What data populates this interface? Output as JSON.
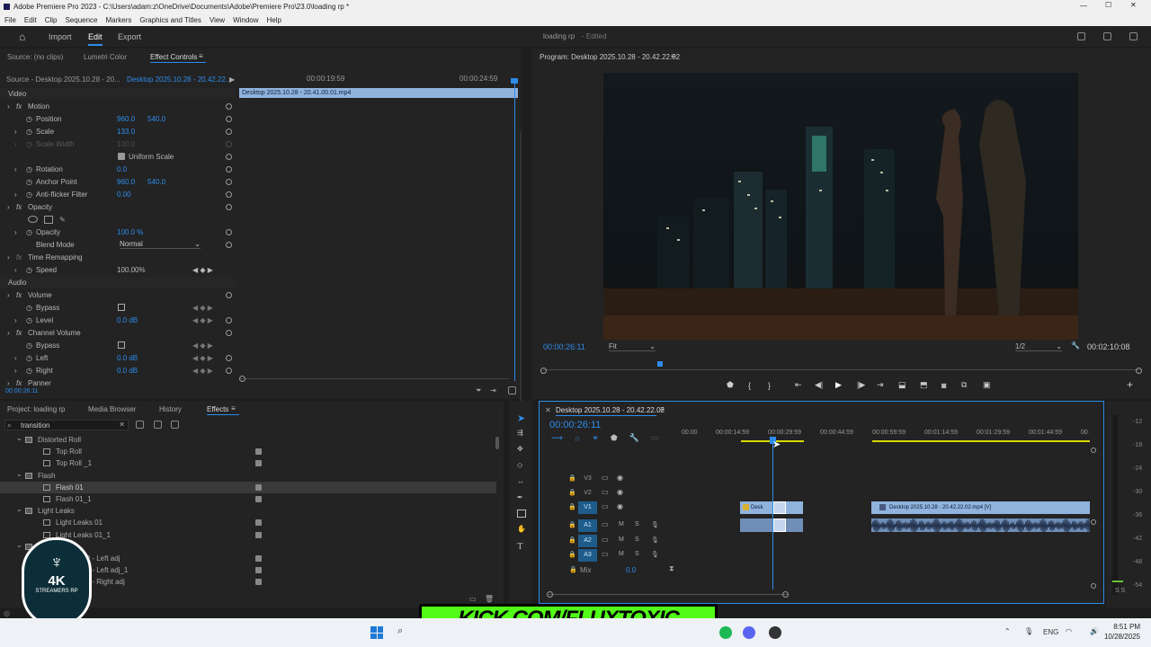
{
  "window": {
    "title": "Adobe Premiere Pro 2023 - C:\\Users\\adam:z\\OneDrive\\Documents\\Adobe\\Premiere Pro\\23.0\\loading rp *"
  },
  "menu": [
    "File",
    "Edit",
    "Clip",
    "Sequence",
    "Markers",
    "Graphics and Titles",
    "View",
    "Window",
    "Help"
  ],
  "workspace": {
    "tabs": [
      "Import",
      "Edit",
      "Export"
    ],
    "active": "Edit",
    "project_name": "loading rp",
    "status": "- Edited"
  },
  "source_panel": {
    "tabs": [
      "Source: (no clips)",
      "Lumetri Color",
      "Effect Controls"
    ],
    "source_clip": "Source - Desktop 2025.10.28 - 20...",
    "seq_clip": "Desktop 2025.10.28 - 20.42.22...",
    "timecode_a": "00:00:19:59",
    "timecode_b": "00:00:24:59",
    "clip_bar": "Desktop 2025.10.28 - 20.41.00.01.mp4",
    "current_time": "00:00:26:11"
  },
  "effects": {
    "video_header": "Video",
    "audio_header": "Audio",
    "motion": "Motion",
    "position_label": "Position",
    "position_x": "960.0",
    "position_y": "540.0",
    "scale_label": "Scale",
    "scale_val": "133.0",
    "scale_width_label": "Scale Width",
    "scale_width_val": "100.0",
    "uniform_scale": "Uniform Scale",
    "rotation_label": "Rotation",
    "rotation_val": "0.0",
    "anchor_label": "Anchor Point",
    "anchor_x": "960.0",
    "anchor_y": "540.0",
    "antiflicker_label": "Anti-flicker Filter",
    "antiflicker_val": "0.00",
    "opacity_group": "Opacity",
    "opacity_label": "Opacity",
    "opacity_val": "100.0 %",
    "blend_label": "Blend Mode",
    "blend_val": "Normal",
    "time_remap": "Time Remapping",
    "speed_label": "Speed",
    "speed_val": "100.00%",
    "volume": "Volume",
    "bypass_label": "Bypass",
    "level_label": "Level",
    "level_val": "0.0 dB",
    "channel_volume": "Channel Volume",
    "bypass2_label": "Bypass",
    "left_label": "Left",
    "left_val": "0.0 dB",
    "right_label": "Right",
    "right_val": "0.0 dB",
    "panner": "Panner"
  },
  "program": {
    "title": "Program: Desktop 2025.10.28 - 20.42.22.02",
    "timecode": "00:00:26:11",
    "fit": "Fit",
    "resolution": "1/2",
    "duration": "00:02:10:08"
  },
  "project_panel": {
    "tabs": [
      "Project: loading rp",
      "Media Browser",
      "History",
      "Effects"
    ],
    "active": "Effects",
    "search": "transition",
    "items": [
      {
        "label": "Distorted Roll",
        "indent": 1,
        "folder": true
      },
      {
        "label": "Top Roll",
        "indent": 2,
        "folder": false
      },
      {
        "label": "Top Roll _1",
        "indent": 2,
        "folder": false
      },
      {
        "label": "Flash",
        "indent": 1,
        "folder": true
      },
      {
        "label": "Flash 01",
        "indent": 2,
        "folder": false,
        "selected": true
      },
      {
        "label": "Flash 01_1",
        "indent": 2,
        "folder": false
      },
      {
        "label": "Light Leaks",
        "indent": 1,
        "folder": true
      },
      {
        "label": "Light Leaks 01",
        "indent": 2,
        "folder": false
      },
      {
        "label": "Light Leaks 01_1",
        "indent": 2,
        "folder": false
      },
      {
        "label": "LOGIC UP",
        "indent": 1,
        "folder": true
      },
      {
        "label": "LOGIC UP - Left adj",
        "indent": 2,
        "folder": false
      },
      {
        "label": "LOGIC UP - Left adj_1",
        "indent": 2,
        "folder": false
      },
      {
        "label": "LOGIC UP - Right adj",
        "indent": 2,
        "folder": false
      }
    ]
  },
  "timeline": {
    "sequence": "Desktop 2025.10.28 - 20.42.22.02",
    "timecode": "00:00:26:11",
    "ruler": [
      "00:00",
      "00:00:14:59",
      "00:00:29:59",
      "00:00:44:59",
      "00:00:59:59",
      "00:01:14:59",
      "00:01:29:59",
      "00:01:44:59",
      "00"
    ],
    "tracks": [
      "V3",
      "V2",
      "V1",
      "A1",
      "A2",
      "A3"
    ],
    "mix_label": "Mix",
    "mix_val": "0.0",
    "clip_small": "Desk",
    "clip_large": "Desktop 2025.10.28 - 20.42.22.02.mp4 [V]"
  },
  "meter": {
    "scale": [
      "-12",
      "-18",
      "-24",
      "-30",
      "-36",
      "-42",
      "-48",
      "-54"
    ],
    "solo": "S S"
  },
  "watermark": {
    "logo_text": "4K",
    "logo_sub": "STREAMERS RP",
    "banner": "KICK.COM/FLUXTOXIC"
  },
  "taskbar": {
    "lang": "ENG",
    "time": "8:51 PM",
    "date": "10/28/2025"
  }
}
